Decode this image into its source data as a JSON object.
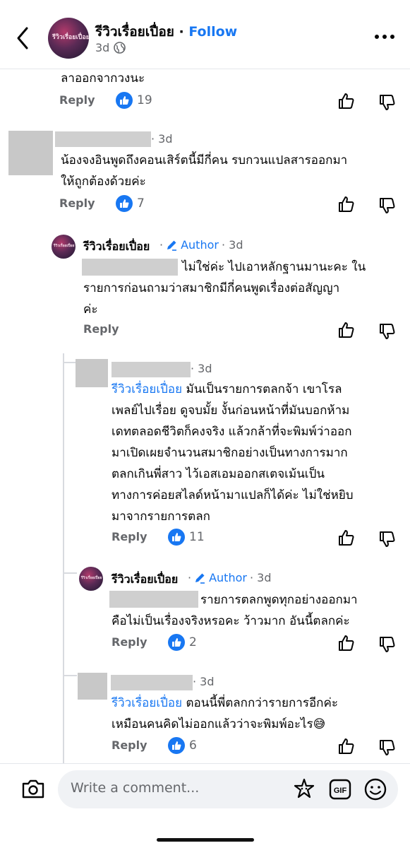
{
  "header": {
    "page_name": "รีวิวเรื่อยเปื่อย",
    "separator": " · ",
    "follow_label": "Follow",
    "time": "3d",
    "avatar_text": "รีวิวเรื่อยเปื่อย"
  },
  "comments": [
    {
      "text": "ลาออกจากวงนะ",
      "reply": "Reply",
      "likes": "19"
    },
    {
      "time": "· 3d",
      "text_line1": "น้องจงอินพูดถึงคอนเสิร์ตนี้มีกี่คน รบกวนแปลสารออกมา",
      "text_line2": "ให้ถูกต้องด้วยค่ะ",
      "reply": "Reply",
      "likes": "7"
    },
    {
      "name": "รีวิวเรื่อยเปื่อย",
      "author": "Author",
      "time": "· 3d",
      "text_line1": "ไม่ใช่ค่ะ ไปเอาหลักฐานมานะคะ ใน",
      "text_line2": "รายการก่อนถามว่าสมาชิกมีกี่คนพูดเรื่องต่อสัญญา",
      "text_line3": "ค่ะ",
      "reply": "Reply"
    },
    {
      "time": "· 3d",
      "mention": "รีวิวเรื่อยเปื่อย",
      "text_line1": " มันเป็นรายการตลกจ้า เขาโรล",
      "text_line2": "เพลย์ไปเรื่อย ดูจบมั้ย งั้นก่อนหน้าที่มันบอกห้าม",
      "text_line3": "เดทตลอดชีวิตก็คงจริง แล้วกล้าที่จะพิมพ์ว่าออก",
      "text_line4": "มาเปิดเผยจำนวนสมาชิกอย่างเป็นทางการมาก",
      "text_line5": "ตลกเกินพี่สาว ไว้เอสเอมออกสเตจเม้นเป็น",
      "text_line6": "ทางการค่อยสไลด์หน้ามาแปลก็ได้ค่ะ ไม่ใช่หยิบ",
      "text_line7": "มาจากรายการตลก",
      "reply": "Reply",
      "likes": "11"
    },
    {
      "name": "รีวิวเรื่อยเปื่อย",
      "author": "Author",
      "time": "· 3d",
      "text_line1": "รายการตลกพูดทุกอย่างออกมา",
      "text_line2": "คือไม่เป็นเรื่องจริงหรอคะ ว้าวมาก อันนี้ตลกค่ะ",
      "reply": "Reply",
      "likes": "2"
    },
    {
      "time": "· 3d",
      "mention": "รีวิวเรื่อยเปื่อย",
      "text_line1": " ตอนนี้พี่ตลกกว่ารายการอีกค่ะ",
      "text_line2": "เหมือนคนคิดไม่ออกแล้วว่าจะพิมพ์อะไร😅",
      "reply": "Reply",
      "likes": "6"
    }
  ],
  "composer": {
    "placeholder": "Write a comment..."
  },
  "colors": {
    "accent": "#1877f2",
    "muted": "#65676b"
  }
}
